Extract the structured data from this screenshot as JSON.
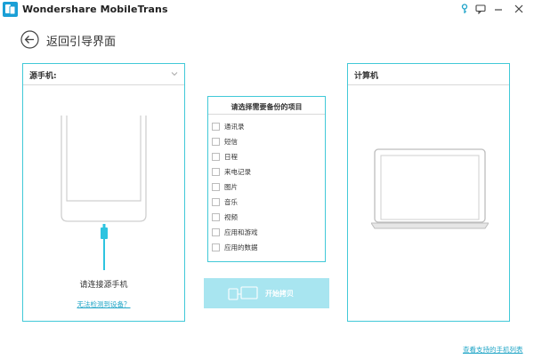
{
  "titlebar": {
    "app_title": "Wondershare MobileTrans",
    "icons": [
      "app-logo-icon",
      "key-icon",
      "feedback-icon",
      "minimize-icon",
      "close-icon"
    ]
  },
  "nav": {
    "back_label": "返回引导界面"
  },
  "source_panel": {
    "title": "源手机:",
    "connect_text": "请连接源手机",
    "detect_link": "无法检测到设备？"
  },
  "dest_panel": {
    "title": "计算机"
  },
  "content_select": {
    "title": "请选择需要备份的项目",
    "items": [
      {
        "label": "通讯录",
        "checked": false
      },
      {
        "label": "短信",
        "checked": false
      },
      {
        "label": "日程",
        "checked": false
      },
      {
        "label": "来电记录",
        "checked": false
      },
      {
        "label": "图片",
        "checked": false
      },
      {
        "label": "音乐",
        "checked": false
      },
      {
        "label": "视频",
        "checked": false
      },
      {
        "label": "应用和游戏",
        "checked": false
      },
      {
        "label": "应用的数据",
        "checked": false
      }
    ]
  },
  "actions": {
    "start_label": "开始拷贝",
    "start_enabled": false
  },
  "footer": {
    "support_link": "查看支持的手机列表"
  },
  "colors": {
    "accent": "#41c9d8",
    "link": "#21a6c7",
    "button_disabled": "#a8e5f0",
    "cable": "#2ec4e0"
  }
}
